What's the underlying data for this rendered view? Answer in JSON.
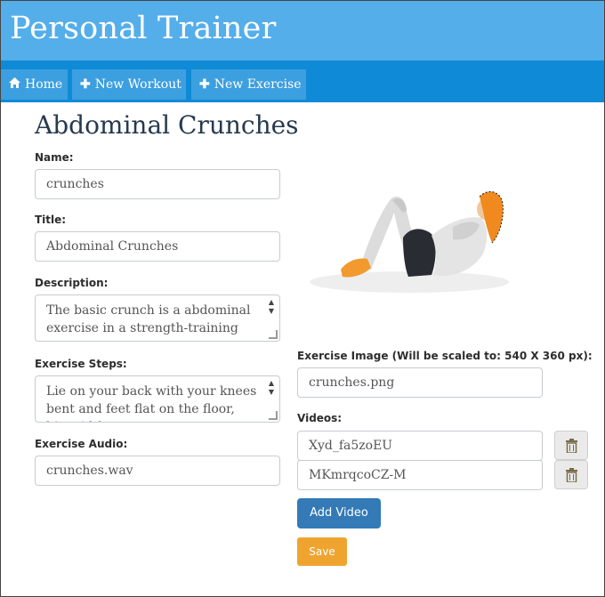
{
  "app": {
    "title": "Personal Trainer"
  },
  "nav": {
    "items": [
      {
        "label": "Home",
        "icon": "home-icon"
      },
      {
        "label": "New Workout",
        "icon": "plus-icon"
      },
      {
        "label": "New Exercise",
        "icon": "plus-icon"
      }
    ]
  },
  "page": {
    "title": "Abdominal Crunches"
  },
  "form": {
    "name": {
      "label": "Name:",
      "value": "crunches"
    },
    "title": {
      "label": "Title:",
      "value": "Abdominal Crunches"
    },
    "description": {
      "label": "Description:",
      "value": "The basic crunch is a abdominal exercise in a strength-training"
    },
    "steps": {
      "label": "Exercise Steps:",
      "value": "Lie on your back with your knees bent and feet flat on the floor, hip-width apart."
    },
    "audio": {
      "label": "Exercise Audio:",
      "value": "crunches.wav"
    },
    "image": {
      "label": "Exercise Image (Will be scaled to: 540 X 360 px):",
      "value": "crunches.png"
    },
    "videos": {
      "label": "Videos:",
      "items": [
        "Xyd_fa5zoEU",
        "MKmrqcoCZ-M"
      ]
    },
    "add_video_label": "Add Video",
    "save_label": "Save"
  },
  "colors": {
    "header_bg": "#54aeea",
    "navbar_bg": "#0f8ad6",
    "primary": "#337ab7",
    "warning": "#f0a430"
  }
}
